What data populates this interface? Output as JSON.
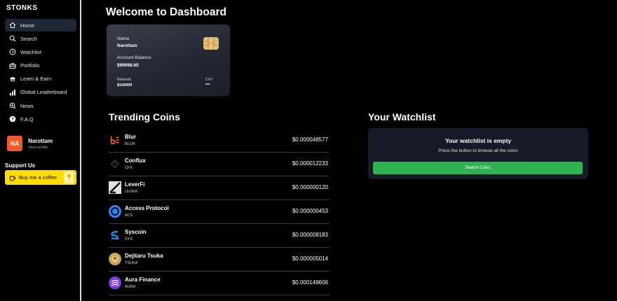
{
  "sidebar": {
    "brand": "STONKS",
    "items": [
      {
        "label": "Home",
        "icon": "home-icon"
      },
      {
        "label": "Search",
        "icon": "search-icon"
      },
      {
        "label": "Watchlist",
        "icon": "clock-icon"
      },
      {
        "label": "Portfolio",
        "icon": "briefcase-icon"
      },
      {
        "label": "Learn & Earn",
        "icon": "graduation-cap-icon"
      },
      {
        "label": "Global Leaderboard",
        "icon": "bar-chart-icon"
      },
      {
        "label": "News",
        "icon": "newspaper-icon"
      },
      {
        "label": "F.A.Q",
        "icon": "question-icon"
      }
    ],
    "profile": {
      "initials": "NA",
      "name": "Narottam",
      "link": "View profile"
    },
    "support_title": "Support Us",
    "coffee_label": "Buy me a coffee"
  },
  "main": {
    "title": "Welcome to Dashboard",
    "card": {
      "name_label": "Name",
      "name_value": "Narottam",
      "balance_label": "Account Balance",
      "balance_value": "$99998.65",
      "networth_label": "Networth",
      "networth_value": "$100000",
      "cvv_label": "CVV",
      "cvv_value": "***"
    },
    "trending_title": "Trending Coins",
    "coins": [
      {
        "name": "Blur",
        "symbol": "BLUR",
        "price": "$0.000048577",
        "color": "#f05a28"
      },
      {
        "name": "Conflux",
        "symbol": "CFX",
        "price": "$0.000012233",
        "color": "#111111"
      },
      {
        "name": "LeverFi",
        "symbol": "LEVER",
        "price": "$0.000000120",
        "color": "#d8d8d8"
      },
      {
        "name": "Access Protocol",
        "symbol": "ACS",
        "price": "$0.000000453",
        "color": "#3b82f6"
      },
      {
        "name": "Syscoin",
        "symbol": "SYS",
        "price": "$0.000008183",
        "color": "#1e88e5"
      },
      {
        "name": "Dejitaru Tsuka",
        "symbol": "TSUKA",
        "price": "$0.000005014",
        "color": "#c9a25a"
      },
      {
        "name": "Aura Finance",
        "symbol": "AURA",
        "price": "$0.000149606",
        "color": "#7c3aed"
      }
    ],
    "watchlist_title": "Your Watchlist",
    "watchlist": {
      "empty_title": "Your watchlist is empty",
      "empty_sub": "Press the button to browse all the coins",
      "button_label": "Search Coins"
    }
  }
}
